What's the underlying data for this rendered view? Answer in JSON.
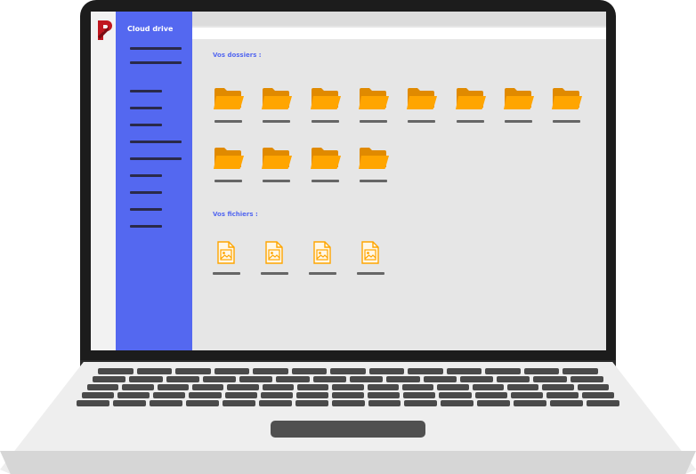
{
  "app": {
    "title": "Cloud drive",
    "accent": "#5468f0",
    "folder_color": "#ffa500",
    "logo_color": "#c0161f"
  },
  "sidebar": {
    "items": [
      {
        "icon": "placeholder-line"
      },
      {
        "icon": "placeholder-line"
      },
      {
        "icon": "placeholder-line"
      },
      {
        "icon": "placeholder-line"
      },
      {
        "icon": "placeholder-line"
      },
      {
        "icon": "placeholder-line"
      },
      {
        "icon": "placeholder-line"
      },
      {
        "icon": "placeholder-line"
      },
      {
        "icon": "placeholder-line"
      },
      {
        "icon": "placeholder-line"
      },
      {
        "icon": "placeholder-line"
      }
    ]
  },
  "main": {
    "folders_title": "Vos dossiers :",
    "files_title": "Vos fichiers :",
    "folders": [
      {
        "icon": "folder-icon"
      },
      {
        "icon": "folder-icon"
      },
      {
        "icon": "folder-icon"
      },
      {
        "icon": "folder-icon"
      },
      {
        "icon": "folder-icon"
      },
      {
        "icon": "folder-icon"
      },
      {
        "icon": "folder-icon"
      },
      {
        "icon": "folder-icon"
      },
      {
        "icon": "folder-icon"
      },
      {
        "icon": "folder-icon"
      },
      {
        "icon": "folder-icon"
      },
      {
        "icon": "folder-icon"
      }
    ],
    "files": [
      {
        "icon": "image-file-icon"
      },
      {
        "icon": "image-file-icon"
      },
      {
        "icon": "image-file-icon"
      },
      {
        "icon": "image-file-icon"
      }
    ]
  }
}
